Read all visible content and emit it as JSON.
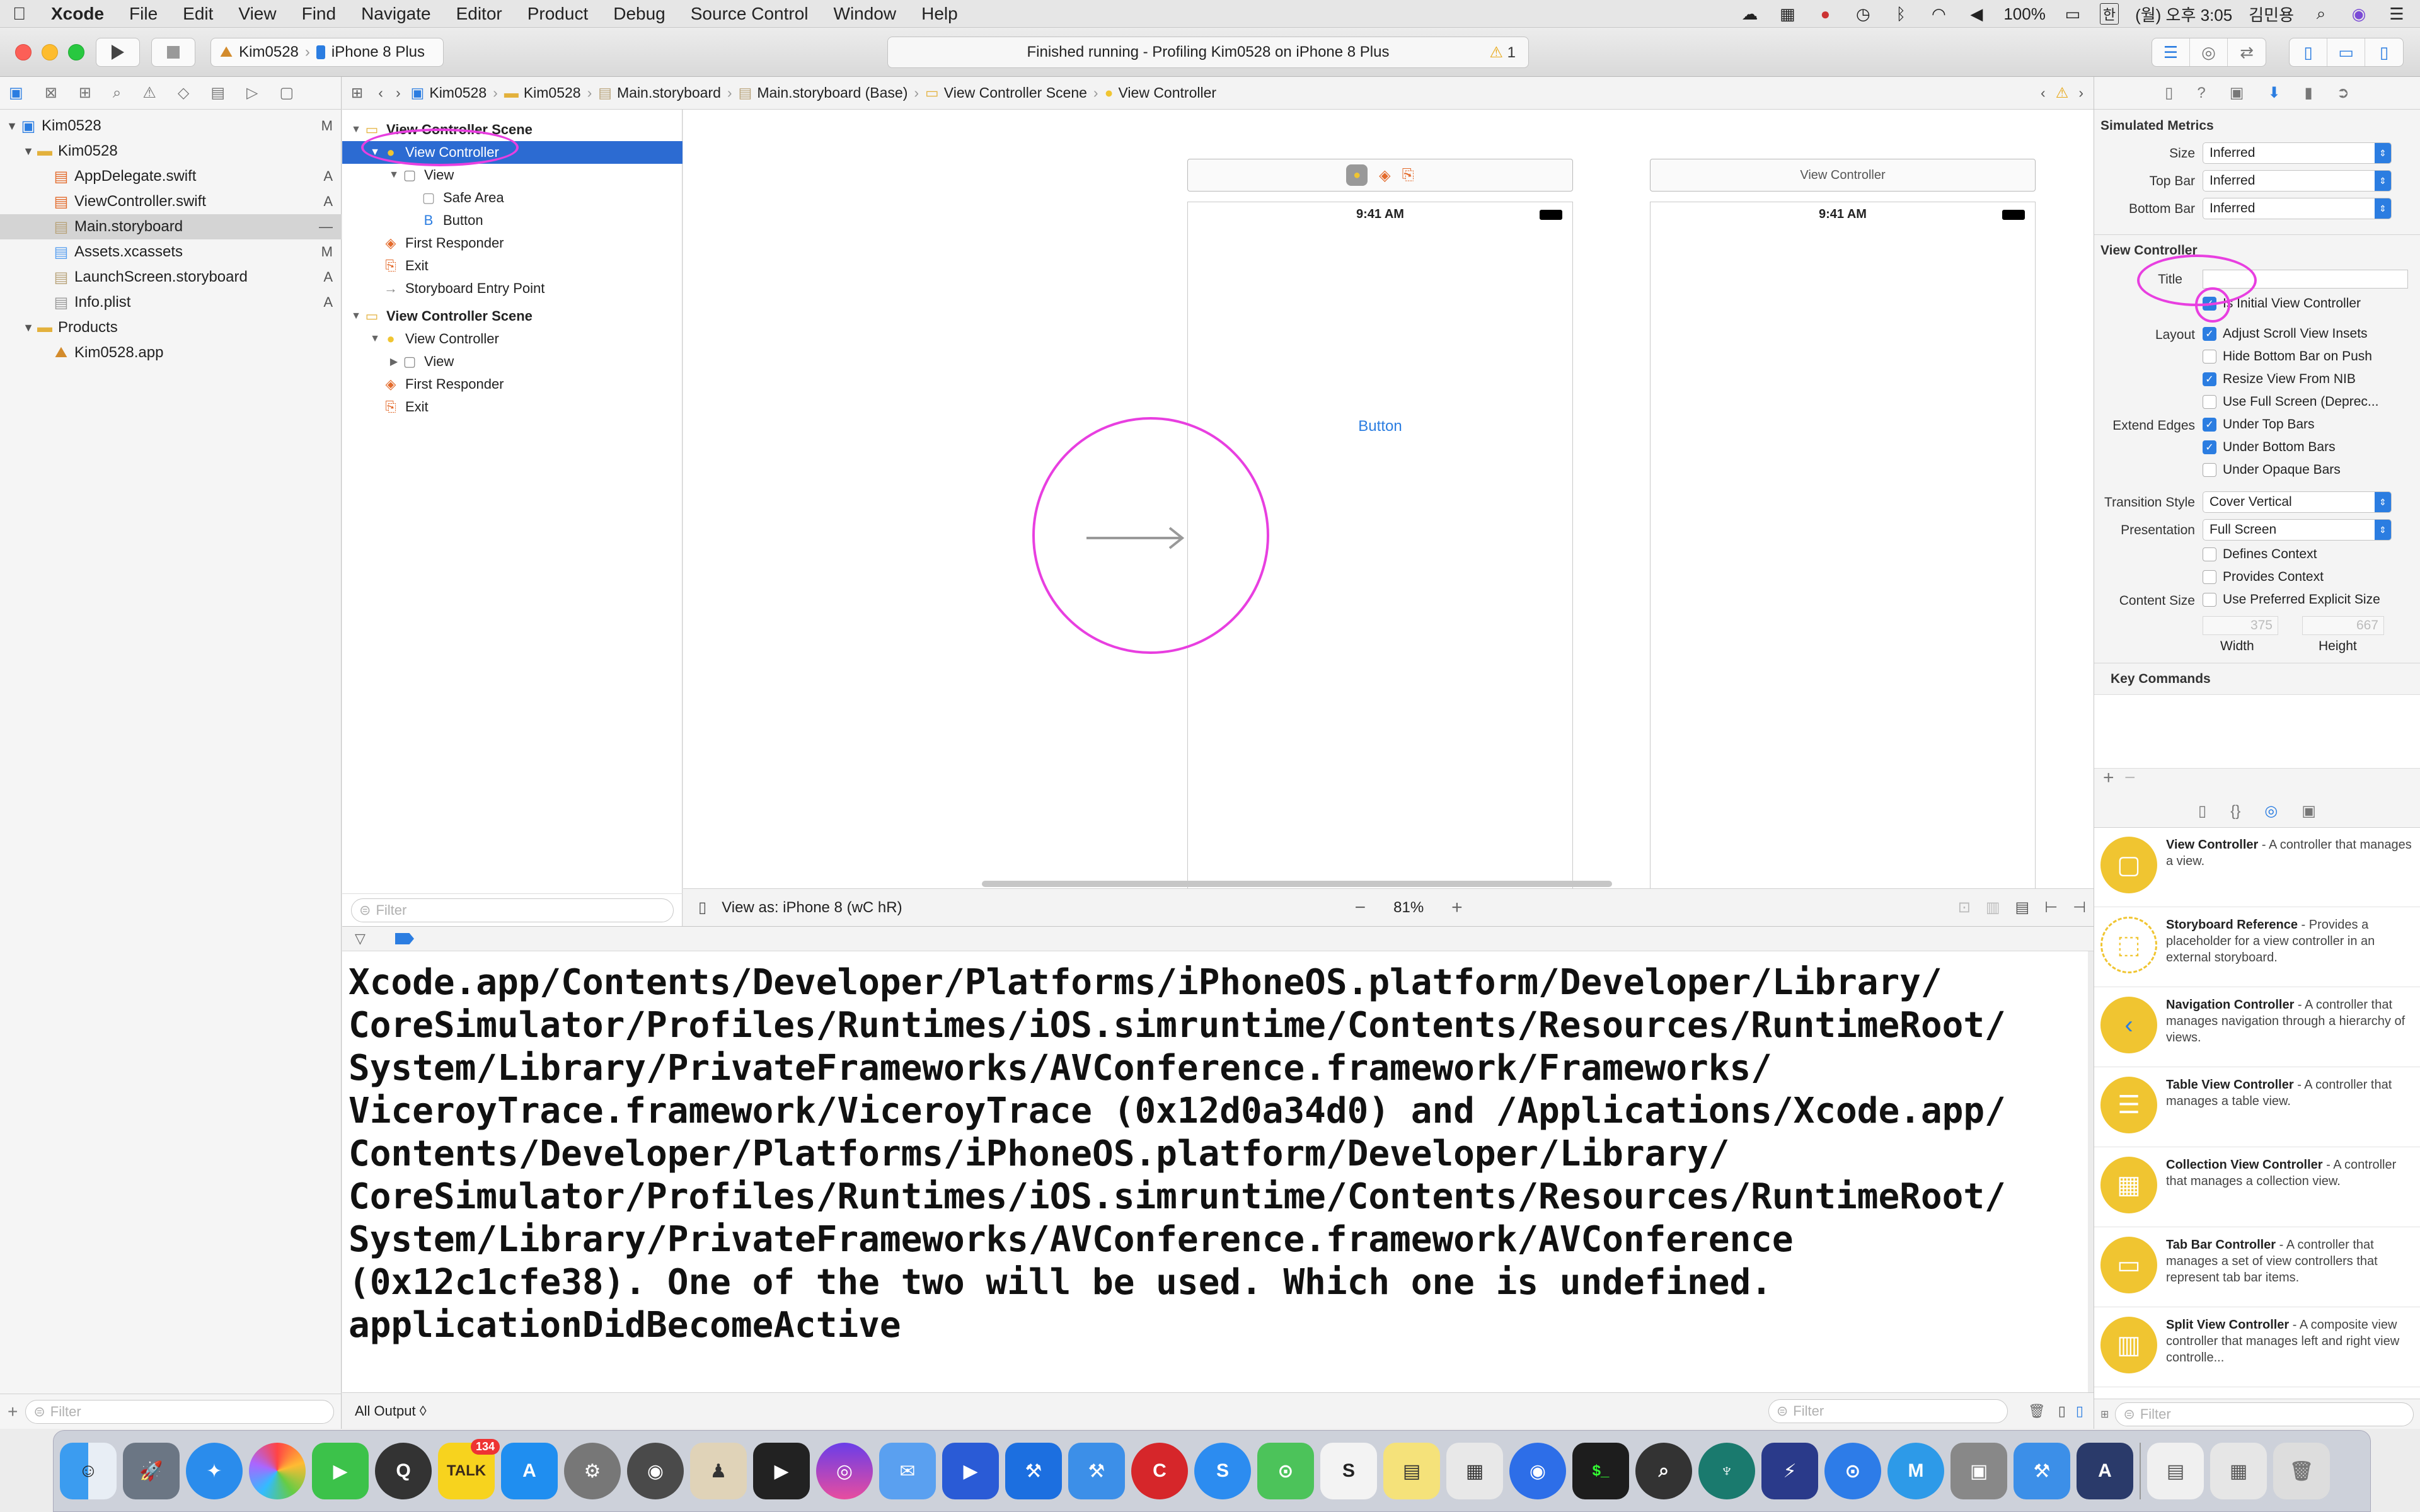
{
  "menubar": {
    "app_name": "Xcode",
    "items": [
      "File",
      "Edit",
      "View",
      "Find",
      "Navigate",
      "Editor",
      "Product",
      "Debug",
      "Source Control",
      "Window",
      "Help"
    ],
    "battery": "100%",
    "clock": "(월) 오후 3:05",
    "user": "김민용",
    "ime": "한"
  },
  "toolbar": {
    "scheme_project": "Kim0528",
    "scheme_device": "iPhone 8 Plus",
    "activity_text": "Finished running - Profiling Kim0528 on iPhone 8 Plus",
    "warning_count": "1"
  },
  "navigator": {
    "items": [
      {
        "label": "Kim0528",
        "badge": "M",
        "indent": 0
      },
      {
        "label": "Kim0528",
        "badge": "",
        "indent": 1
      },
      {
        "label": "AppDelegate.swift",
        "badge": "A",
        "indent": 2
      },
      {
        "label": "ViewController.swift",
        "badge": "A",
        "indent": 2
      },
      {
        "label": "Main.storyboard",
        "badge": "—",
        "indent": 2
      },
      {
        "label": "Assets.xcassets",
        "badge": "M",
        "indent": 2
      },
      {
        "label": "LaunchScreen.storyboard",
        "badge": "A",
        "indent": 2
      },
      {
        "label": "Info.plist",
        "badge": "A",
        "indent": 2
      },
      {
        "label": "Products",
        "badge": "",
        "indent": 1
      },
      {
        "label": "Kim0528.app",
        "badge": "",
        "indent": 2
      }
    ],
    "filter_placeholder": "Filter"
  },
  "jumpbar": {
    "crumbs": [
      "Kim0528",
      "Kim0528",
      "Main.storyboard",
      "Main.storyboard (Base)",
      "View Controller Scene",
      "View Controller"
    ]
  },
  "outline": {
    "rows": [
      {
        "label": "View Controller Scene",
        "indent": 0
      },
      {
        "label": "View Controller",
        "indent": 1
      },
      {
        "label": "View",
        "indent": 2
      },
      {
        "label": "Safe Area",
        "indent": 3
      },
      {
        "label": "Button",
        "indent": 3
      },
      {
        "label": "First Responder",
        "indent": 1
      },
      {
        "label": "Exit",
        "indent": 1
      },
      {
        "label": "Storyboard Entry Point",
        "indent": 1
      },
      {
        "label": "View Controller Scene",
        "indent": 0
      },
      {
        "label": "View Controller",
        "indent": 1
      },
      {
        "label": "View",
        "indent": 2
      },
      {
        "label": "First Responder",
        "indent": 1
      },
      {
        "label": "Exit",
        "indent": 1
      }
    ],
    "filter_placeholder": "Filter"
  },
  "canvas": {
    "scene2_title": "View Controller",
    "status_time": "9:41 AM",
    "button_label": "Button",
    "view_as": "View as: iPhone 8 (wC hR)",
    "zoom": "81%"
  },
  "console": {
    "lines": [
      "Xcode.app/Contents/Developer/Platforms/iPhoneOS.platform/Developer/Library/",
      "CoreSimulator/Profiles/Runtimes/iOS.simruntime/Contents/Resources/RuntimeRoot/",
      "System/Library/PrivateFrameworks/AVConference.framework/Frameworks/",
      "ViceroyTrace.framework/ViceroyTrace (0x12d0a34d0) and /Applications/Xcode.app/",
      "Contents/Developer/Platforms/iPhoneOS.platform/Developer/Library/",
      "CoreSimulator/Profiles/Runtimes/iOS.simruntime/Contents/Resources/RuntimeRoot/",
      "System/Library/PrivateFrameworks/AVConference.framework/AVConference",
      "(0x12c1cfe38). One of the two will be used. Which one is undefined.",
      "applicationDidBecomeActive"
    ],
    "output_selector": "All Output ◊",
    "filter_placeholder": "Filter"
  },
  "inspector": {
    "simulated_metrics": "Simulated Metrics",
    "size_label": "Size",
    "size_value": "Inferred",
    "topbar_label": "Top Bar",
    "topbar_value": "Inferred",
    "bottombar_label": "Bottom Bar",
    "bottombar_value": "Inferred",
    "vc_section": "View Controller",
    "title_label": "Title",
    "initial_vc": "Is Initial View Controller",
    "layout_label": "Layout",
    "adjust_scroll": "Adjust Scroll View Insets",
    "hide_bottom": "Hide Bottom Bar on Push",
    "resize_nib": "Resize View From NIB",
    "full_screen": "Use Full Screen (Deprec...",
    "extend_edges_label": "Extend Edges",
    "under_top": "Under Top Bars",
    "under_bottom": "Under Bottom Bars",
    "under_opaque": "Under Opaque Bars",
    "transition_label": "Transition Style",
    "transition_value": "Cover Vertical",
    "presentation_label": "Presentation",
    "presentation_value": "Full Screen",
    "defines_context": "Defines Context",
    "provides_context": "Provides Context",
    "content_size_label": "Content Size",
    "preferred_size": "Use Preferred Explicit Size",
    "width_value": "375",
    "height_value": "667",
    "width_label": "Width",
    "height_label": "Height",
    "key_commands": "Key Commands"
  },
  "library": {
    "items": [
      {
        "title": "View Controller",
        "desc": " - A controller that manages a view."
      },
      {
        "title": "Storyboard Reference",
        "desc": " - Provides a placeholder for a view controller in an external storyboard."
      },
      {
        "title": "Navigation Controller",
        "desc": " - A controller that manages navigation through a hierarchy of views."
      },
      {
        "title": "Table View Controller",
        "desc": " - A controller that manages a table view."
      },
      {
        "title": "Collection View Controller",
        "desc": " - A controller that manages a collection view."
      },
      {
        "title": "Tab Bar Controller",
        "desc": " - A controller that manages a set of view controllers that represent tab bar items."
      },
      {
        "title": "Split View Controller",
        "desc": " - A composite view controller that manages left and right view controlle..."
      }
    ],
    "filter_placeholder": "Filter"
  },
  "dock": {
    "talk_badge": "134"
  },
  "colors": {
    "accent": "#2b7de1",
    "selection": "#2c6bd2",
    "annotation": "#e83fe0",
    "library_icon": "#f0c531"
  }
}
